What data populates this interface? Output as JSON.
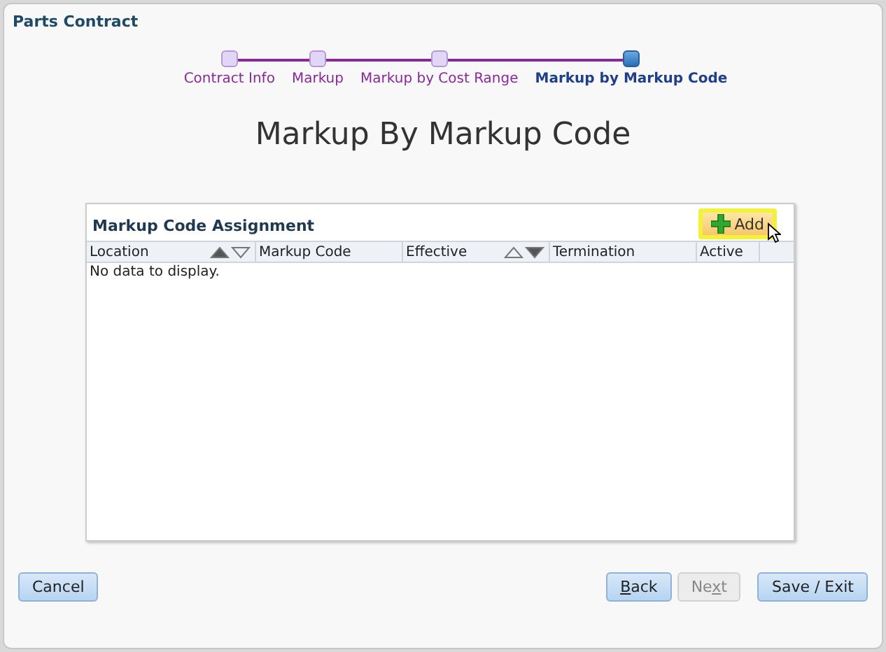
{
  "window": {
    "title": "Parts Contract"
  },
  "train": [
    {
      "label": "Contract Info",
      "selected": false
    },
    {
      "label": "Markup",
      "selected": false
    },
    {
      "label": "Markup by Cost Range",
      "selected": false
    },
    {
      "label": "Markup by Markup Code",
      "selected": true
    }
  ],
  "heading": "Markup By Markup Code",
  "panel": {
    "title": "Markup Code Assignment",
    "add_button": {
      "label": "Add",
      "focused": true
    },
    "columns": [
      {
        "label": "Location",
        "sorted": true,
        "ascending": true
      },
      {
        "label": "Markup Code",
        "sorted": false
      },
      {
        "label": "Effective",
        "sorted": true,
        "ascending": false
      },
      {
        "label": "Termination",
        "sorted": false
      },
      {
        "label": "Active",
        "sorted": false
      }
    ],
    "empty_text": "No data to display."
  },
  "footer": {
    "left": [
      {
        "label": "Cancel",
        "disabled": false
      }
    ],
    "nav": [
      {
        "access_key": "B",
        "label_after": "ack",
        "disabled": false
      },
      {
        "label": "Ne",
        "access_key": "x",
        "label_after": "t",
        "disabled": true
      }
    ],
    "right": [
      {
        "label": "Save / Exit",
        "disabled": false
      }
    ]
  }
}
